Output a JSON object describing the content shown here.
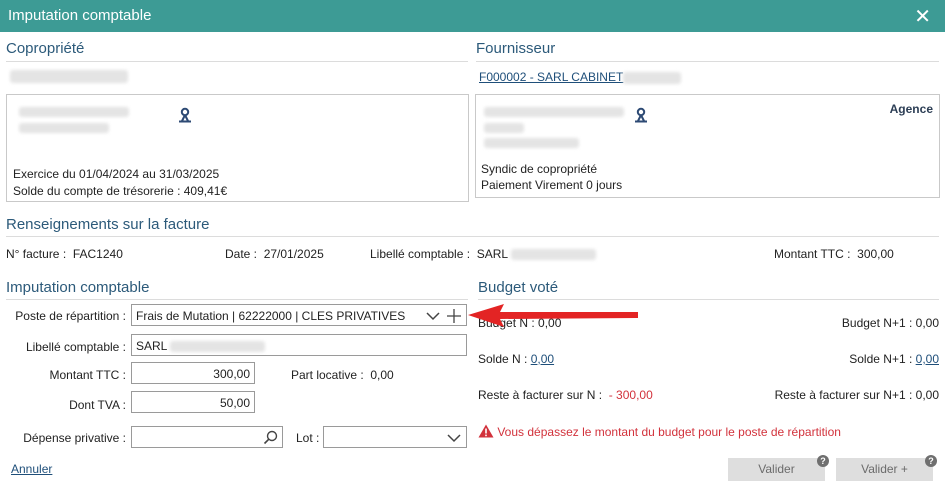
{
  "window": {
    "title": "Imputation comptable"
  },
  "copropriete": {
    "title": "Copropriété",
    "exercice": "Exercice du 01/04/2024 au 31/03/2025",
    "solde": "Solde du compte de trésorerie : 409,41€"
  },
  "fournisseur": {
    "title": "Fournisseur",
    "link": "F000002 - SARL CABINET",
    "agence": "Agence",
    "type": "Syndic de copropriété",
    "paiement": "Paiement Virement 0 jours"
  },
  "facture": {
    "title": "Renseignements sur la facture",
    "num_label": "N° facture :",
    "num_value": "FAC1240",
    "date_label": "Date :",
    "date_value": "27/01/2025",
    "libelle_label": "Libellé comptable :",
    "libelle_value": "SARL",
    "montant_label": "Montant TTC :",
    "montant_value": "300,00"
  },
  "imputation": {
    "title": "Imputation comptable",
    "poste_label": "Poste de répartition :",
    "poste_value": "Frais de Mutation | 62222000 | CLES PRIVATIVES",
    "libelle_label": "Libellé comptable :",
    "libelle_value": "SARL",
    "montant_label": "Montant TTC :",
    "montant_value": "300,00",
    "part_label": "Part locative :",
    "part_value": "0,00",
    "tva_label": "Dont TVA :",
    "tva_value": "50,00",
    "depense_label": "Dépense privative :",
    "depense_value": "",
    "lot_label": "Lot :",
    "lot_value": ""
  },
  "budget": {
    "title": "Budget voté",
    "budget_n_label": "Budget N :",
    "budget_n_value": "0,00",
    "budget_n1_label": "Budget N+1 :",
    "budget_n1_value": "0,00",
    "solde_n_label": "Solde N :",
    "solde_n_value": "0,00",
    "solde_n1_label": "Solde N+1 :",
    "solde_n1_value": "0,00",
    "reste_n_label": "Reste à facturer sur N :",
    "reste_n_value": "- 300,00",
    "reste_n1_label": "Reste à facturer sur N+1 :",
    "reste_n1_value": "0,00",
    "warning": "Vous dépassez le montant du budget pour le poste de répartition"
  },
  "actions": {
    "annuler": "Annuler",
    "valider": "Valider",
    "valider_plus": "Valider +",
    "help": "?"
  },
  "colors": {
    "header": "#3d9b95",
    "section_title": "#2c5a7a",
    "link": "#1f4f7a",
    "warning": "#d2323c",
    "arrow": "#e32424"
  }
}
